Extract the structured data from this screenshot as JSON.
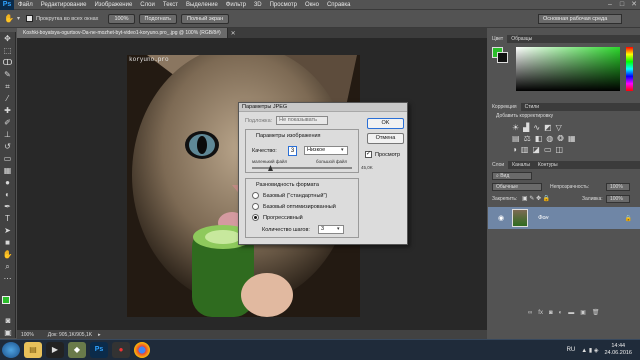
{
  "app": {
    "logo": "Ps",
    "menu": [
      "Файл",
      "Редактирование",
      "Изображение",
      "Слои",
      "Текст",
      "Выделение",
      "Фильтр",
      "3D",
      "Просмотр",
      "Окно",
      "Справка"
    ],
    "window_controls": [
      "–",
      "□",
      "✕"
    ]
  },
  "options_bar": {
    "scroll_all_label": "Прокрутка во всех окнах",
    "btn_100": "100%",
    "btn_fit": "Подогнать",
    "btn_fullscreen": "Полный экран",
    "workspace": "Основная рабочая среда"
  },
  "document": {
    "tab_title": "Koshki-boyatsya-ogurtsov-Da-ne-mozhet-byt-video1-koryuno.pro_.jpg @ 100% (RGB/8#)",
    "watermark": "koryuno.pro",
    "status_zoom": "100%",
    "status_doc": "Док: 905,1K/905,1K"
  },
  "dialog": {
    "title": "Параметры JPEG",
    "matte_label": "Подложка:",
    "matte_value": "Не показывать",
    "image_params_title": "Параметры изображения",
    "quality_label": "Качество:",
    "quality_value": "3",
    "quality_preset": "Низкое",
    "small_file": "маленький файл",
    "large_file": "большой файл",
    "ok": "OK",
    "cancel": "Отмена",
    "preview_label": "Просмотр",
    "preview_checked": true,
    "file_size": "45,0K",
    "format_title": "Разновидность формата",
    "options": [
      "Базовый (\"стандартный\")",
      "Базовый оптимизированный",
      "Прогрессивный"
    ],
    "selected_option": 2,
    "scans_label": "Количество шагов:",
    "scans_value": "3"
  },
  "panels": {
    "color_tabs": [
      "Цвет",
      "Образцы"
    ],
    "adjust_tabs": [
      "Коррекция",
      "Стили"
    ],
    "adjust_title": "Добавить корректировку",
    "layers_tabs": [
      "Слои",
      "Каналы",
      "Контуры"
    ],
    "layers_kind": "Вид",
    "blend_mode": "Обычные",
    "opacity_label": "Непрозрачность:",
    "opacity_value": "100%",
    "lock_label": "Закрепить:",
    "fill_label": "Заливка:",
    "fill_value": "100%",
    "layer_name": "Фон"
  },
  "taskbar": {
    "lang": "RU",
    "time": "14:44",
    "date": "24.06.2016"
  },
  "colors": {
    "accent": "#2fa3ff",
    "panel_bg": "#535353",
    "canvas_bg": "#282828",
    "color_field_green": "#2cd62c"
  }
}
